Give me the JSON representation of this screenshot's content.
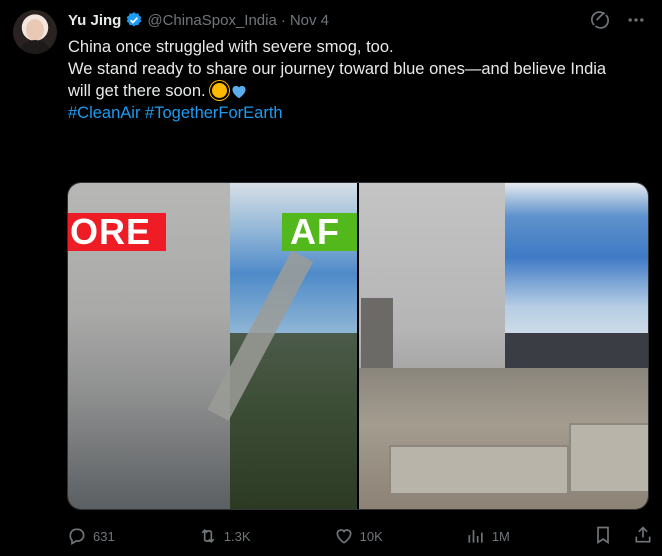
{
  "tweet": {
    "author_name": "Yu Jing",
    "handle": "@ChinaSpox_India",
    "separator": "·",
    "date": "Nov 4",
    "text_line1": "China once struggled with severe smog, too.",
    "text_line2": "We stand ready to share our journey toward blue ones—and  believe India",
    "text_line3": "will get there soon.",
    "hashtags": "#CleanAir #TogetherForEarth",
    "emoji": [
      "sun-emoji",
      "blue-heart-emoji"
    ]
  },
  "media": {
    "left_label": "ORE",
    "right_label": "AF"
  },
  "actions": {
    "replies": "631",
    "reposts": "1.3K",
    "likes": "10K",
    "views": "1M"
  },
  "icons": [
    "grok-icon",
    "more-icon",
    "verified-icon",
    "reply-icon",
    "repost-icon",
    "like-icon",
    "views-icon",
    "bookmark-icon",
    "share-icon"
  ],
  "colors": {
    "background": "#000000",
    "text": "#e7e9ea",
    "secondary": "#71767b",
    "link": "#1d9bf0",
    "before_label": "#ee1c25",
    "after_label": "#52b81c"
  }
}
